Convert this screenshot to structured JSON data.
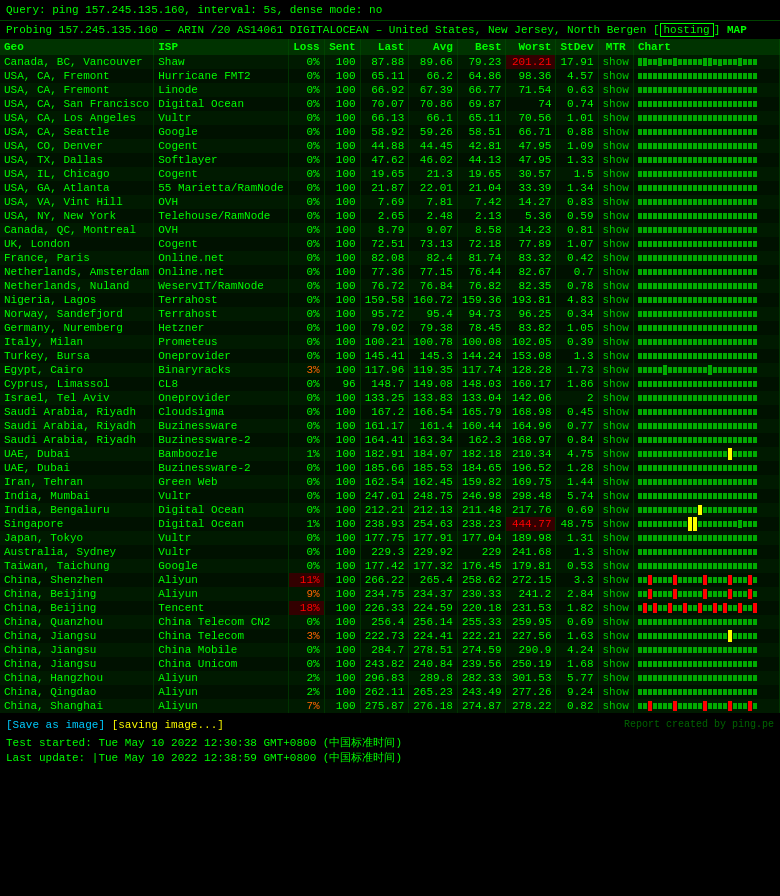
{
  "query_bar": {
    "text": "Query: ping 157.245.135.160, interval: 5s, dense mode: no"
  },
  "probe_bar": {
    "text": "Probing 157.245.135.160 – ARIN /20 AS14061 DIGITALOCEAN – United States, New Jersey, North Bergen",
    "hosting_label": "hosting",
    "map_label": "MAP"
  },
  "table": {
    "headers": [
      "Geo",
      "ISP",
      "Loss",
      "Sent",
      "Last",
      "Avg",
      "Best",
      "Worst",
      "StDev",
      "MTR",
      "Chart"
    ],
    "rows": [
      {
        "geo": "Canada, BC, Vancouver",
        "isp": "Shaw",
        "loss": "0%",
        "sent": 100,
        "last": 87.88,
        "avg": 89.66,
        "best": 79.23,
        "worst": 201.21,
        "stdev": 17.91,
        "mtr": "show",
        "worst_high": true,
        "chart": "green_dense"
      },
      {
        "geo": "USA, CA, Fremont",
        "isp": "Hurricane FMT2",
        "loss": "0%",
        "sent": 100,
        "last": 65.11,
        "avg": 66.2,
        "best": 64.86,
        "worst": 98.36,
        "stdev": 4.57,
        "mtr": "show",
        "worst_high": false,
        "chart": "green_flat"
      },
      {
        "geo": "USA, CA, Fremont",
        "isp": "Linode",
        "loss": "0%",
        "sent": 100,
        "last": 66.92,
        "avg": 67.39,
        "best": 66.77,
        "worst": 71.54,
        "stdev": 0.63,
        "mtr": "show",
        "worst_high": false,
        "chart": "green_flat"
      },
      {
        "geo": "USA, CA, San Francisco",
        "isp": "Digital Ocean",
        "loss": "0%",
        "sent": 100,
        "last": 70.07,
        "avg": 70.86,
        "best": 69.87,
        "worst": 74,
        "stdev": 0.74,
        "mtr": "show",
        "worst_high": false,
        "chart": "green_flat"
      },
      {
        "geo": "USA, CA, Los Angeles",
        "isp": "Vultr",
        "loss": "0%",
        "sent": 100,
        "last": 66.13,
        "avg": 66.1,
        "best": 65.11,
        "worst": 70.56,
        "stdev": 1.01,
        "mtr": "show",
        "worst_high": false,
        "chart": "green_flat"
      },
      {
        "geo": "USA, CA, Seattle",
        "isp": "Google",
        "loss": "0%",
        "sent": 100,
        "last": 58.92,
        "avg": 59.26,
        "best": 58.51,
        "worst": 66.71,
        "stdev": 0.88,
        "mtr": "show",
        "worst_high": false,
        "chart": "green_flat"
      },
      {
        "geo": "USA, CO, Denver",
        "isp": "Cogent",
        "loss": "0%",
        "sent": 100,
        "last": 44.88,
        "avg": 44.45,
        "best": 42.81,
        "worst": 47.95,
        "stdev": 1.09,
        "mtr": "show",
        "worst_high": false,
        "chart": "green_flat"
      },
      {
        "geo": "USA, TX, Dallas",
        "isp": "Softlayer",
        "loss": "0%",
        "sent": 100,
        "last": 47.62,
        "avg": 46.02,
        "best": 44.13,
        "worst": 47.95,
        "stdev": 1.33,
        "mtr": "show",
        "worst_high": false,
        "chart": "green_flat"
      },
      {
        "geo": "USA, IL, Chicago",
        "isp": "Cogent",
        "loss": "0%",
        "sent": 100,
        "last": 19.65,
        "avg": 21.3,
        "best": 19.65,
        "worst": 30.57,
        "stdev": 1.5,
        "mtr": "show",
        "worst_high": false,
        "chart": "green_flat"
      },
      {
        "geo": "USA, GA, Atlanta",
        "isp": "55 Marietta/RamNode",
        "loss": "0%",
        "sent": 100,
        "last": 21.87,
        "avg": 22.01,
        "best": 21.04,
        "worst": 33.39,
        "stdev": 1.34,
        "mtr": "show",
        "worst_high": false,
        "chart": "green_flat"
      },
      {
        "geo": "USA, VA, Vint Hill",
        "isp": "OVH",
        "loss": "0%",
        "sent": 100,
        "last": 7.69,
        "avg": 7.81,
        "best": 7.42,
        "worst": 14.27,
        "stdev": 0.83,
        "mtr": "show",
        "worst_high": false,
        "chart": "green_flat"
      },
      {
        "geo": "USA, NY, New York",
        "isp": "Telehouse/RamNode",
        "loss": "0%",
        "sent": 100,
        "last": 2.65,
        "avg": 2.48,
        "best": 2.13,
        "worst": 5.36,
        "stdev": 0.59,
        "mtr": "show",
        "worst_high": false,
        "chart": "green_flat"
      },
      {
        "geo": "Canada, QC, Montreal",
        "isp": "OVH",
        "loss": "0%",
        "sent": 100,
        "last": 8.79,
        "avg": 9.07,
        "best": 8.58,
        "worst": 14.23,
        "stdev": 0.81,
        "mtr": "show",
        "worst_high": false,
        "chart": "green_flat"
      },
      {
        "geo": "UK, London",
        "isp": "Cogent",
        "loss": "0%",
        "sent": 100,
        "last": 72.51,
        "avg": 73.13,
        "best": 72.18,
        "worst": 77.89,
        "stdev": 1.07,
        "mtr": "show",
        "worst_high": false,
        "chart": "green_flat"
      },
      {
        "geo": "France, Paris",
        "isp": "Online.net",
        "loss": "0%",
        "sent": 100,
        "last": 82.08,
        "avg": 82.4,
        "best": 81.74,
        "worst": 83.32,
        "stdev": 0.42,
        "mtr": "show",
        "worst_high": false,
        "chart": "green_flat"
      },
      {
        "geo": "Netherlands, Amsterdam",
        "isp": "Online.net",
        "loss": "0%",
        "sent": 100,
        "last": 77.36,
        "avg": 77.15,
        "best": 76.44,
        "worst": 82.67,
        "stdev": 0.7,
        "mtr": "show",
        "worst_high": false,
        "chart": "green_flat"
      },
      {
        "geo": "Netherlands, Nuland",
        "isp": "WeservIT/RamNode",
        "loss": "0%",
        "sent": 100,
        "last": 76.72,
        "avg": 76.84,
        "best": 76.82,
        "worst": 82.35,
        "stdev": 0.78,
        "mtr": "show",
        "worst_high": false,
        "chart": "green_flat"
      },
      {
        "geo": "Nigeria, Lagos",
        "isp": "Terrahost",
        "loss": "0%",
        "sent": 100,
        "last": 159.58,
        "avg": 160.72,
        "best": 159.36,
        "worst": 193.81,
        "stdev": 4.83,
        "mtr": "show",
        "worst_high": false,
        "chart": "green_flat"
      },
      {
        "geo": "Norway, Sandefjord",
        "isp": "Terrahost",
        "loss": "0%",
        "sent": 100,
        "last": 95.72,
        "avg": 95.4,
        "best": 94.73,
        "worst": 96.25,
        "stdev": 0.34,
        "mtr": "show",
        "worst_high": false,
        "chart": "green_flat"
      },
      {
        "geo": "Germany, Nuremberg",
        "isp": "Hetzner",
        "loss": "0%",
        "sent": 100,
        "last": 79.02,
        "avg": 79.38,
        "best": 78.45,
        "worst": 83.82,
        "stdev": 1.05,
        "mtr": "show",
        "worst_high": false,
        "chart": "green_flat"
      },
      {
        "geo": "Italy, Milan",
        "isp": "Prometeus",
        "loss": "0%",
        "sent": 100,
        "last": 100.21,
        "avg": 100.78,
        "best": 100.08,
        "worst": 102.05,
        "stdev": 0.39,
        "mtr": "show",
        "worst_high": false,
        "chart": "green_flat"
      },
      {
        "geo": "Turkey, Bursa",
        "isp": "Oneprovider",
        "loss": "0%",
        "sent": 100,
        "last": 145.41,
        "avg": 145.3,
        "best": 144.24,
        "worst": 153.08,
        "stdev": 1.3,
        "mtr": "show",
        "worst_high": false,
        "chart": "green_flat"
      },
      {
        "geo": "Egypt, Cairo",
        "isp": "Binaryracks",
        "loss": "3%",
        "sent": 100,
        "last": 117.96,
        "avg": 119.35,
        "best": 117.74,
        "worst": 128.28,
        "stdev": 1.73,
        "mtr": "show",
        "worst_high": false,
        "loss_warn": true,
        "chart": "green_spikes"
      },
      {
        "geo": "Cyprus, Limassol",
        "isp": "CL8",
        "loss": "0%",
        "sent": 96,
        "last": 148.7,
        "avg": 149.08,
        "best": 148.03,
        "worst": 160.17,
        "stdev": 1.86,
        "mtr": "show",
        "worst_high": false,
        "chart": "green_flat"
      },
      {
        "geo": "Israel, Tel Aviv",
        "isp": "Oneprovider",
        "loss": "0%",
        "sent": 100,
        "last": 133.25,
        "avg": 133.83,
        "best": 133.04,
        "worst": 142.06,
        "stdev": 2,
        "mtr": "show",
        "worst_high": false,
        "chart": "green_flat"
      },
      {
        "geo": "Saudi Arabia, Riyadh",
        "isp": "Cloudsigma",
        "loss": "0%",
        "sent": 100,
        "last": 167.2,
        "avg": 166.54,
        "best": 165.79,
        "worst": 168.98,
        "stdev": 0.45,
        "mtr": "show",
        "worst_high": false,
        "chart": "green_flat"
      },
      {
        "geo": "Saudi Arabia, Riyadh",
        "isp": "Buzinessware",
        "loss": "0%",
        "sent": 100,
        "last": 161.17,
        "avg": 161.4,
        "best": 160.44,
        "worst": 164.96,
        "stdev": 0.77,
        "mtr": "show",
        "worst_high": false,
        "chart": "green_flat"
      },
      {
        "geo": "Saudi Arabia, Riyadh",
        "isp": "Buzinessware-2",
        "loss": "0%",
        "sent": 100,
        "last": 164.41,
        "avg": 163.34,
        "best": 162.3,
        "worst": 168.97,
        "stdev": 0.84,
        "mtr": "show",
        "worst_high": false,
        "chart": "green_flat"
      },
      {
        "geo": "UAE, Dubai",
        "isp": "Bamboozle",
        "loss": "1%",
        "sent": 100,
        "last": 182.91,
        "avg": 184.07,
        "best": 182.18,
        "worst": 210.34,
        "stdev": 4.75,
        "mtr": "show",
        "worst_high": false,
        "chart": "green_spike_one"
      },
      {
        "geo": "UAE, Dubai",
        "isp": "Buzinessware-2",
        "loss": "0%",
        "sent": 100,
        "last": 185.66,
        "avg": 185.53,
        "best": 184.65,
        "worst": 196.52,
        "stdev": 1.28,
        "mtr": "show",
        "worst_high": false,
        "chart": "green_flat"
      },
      {
        "geo": "Iran, Tehran",
        "isp": "Green Web",
        "loss": "0%",
        "sent": 100,
        "last": 162.54,
        "avg": 162.45,
        "best": 159.82,
        "worst": 169.75,
        "stdev": 1.44,
        "mtr": "show",
        "worst_high": false,
        "chart": "green_flat"
      },
      {
        "geo": "India, Mumbai",
        "isp": "Vultr",
        "loss": "0%",
        "sent": 100,
        "last": 247.01,
        "avg": 248.75,
        "best": 246.98,
        "worst": 298.48,
        "stdev": 5.74,
        "mtr": "show",
        "worst_high": false,
        "chart": "green_flat"
      },
      {
        "geo": "India, Bengaluru",
        "isp": "Digital Ocean",
        "loss": "0%",
        "sent": 100,
        "last": 212.21,
        "avg": 212.13,
        "best": 211.48,
        "worst": 217.76,
        "stdev": 0.69,
        "mtr": "show",
        "worst_high": false,
        "chart": "green_yellow_spike"
      },
      {
        "geo": "Singapore",
        "isp": "Digital Ocean",
        "loss": "1%",
        "sent": 100,
        "last": 238.93,
        "avg": 254.63,
        "best": 238.23,
        "worst": 444.77,
        "stdev": 48.75,
        "mtr": "show",
        "worst_high": true,
        "chart": "green_yellow_large_spike"
      },
      {
        "geo": "Japan, Tokyo",
        "isp": "Vultr",
        "loss": "0%",
        "sent": 100,
        "last": 177.75,
        "avg": 177.91,
        "best": 177.04,
        "worst": 189.98,
        "stdev": 1.31,
        "mtr": "show",
        "worst_high": false,
        "chart": "green_flat"
      },
      {
        "geo": "Australia, Sydney",
        "isp": "Vultr",
        "loss": "0%",
        "sent": 100,
        "last": 229.3,
        "avg": 229.92,
        "best": 229,
        "worst": 241.68,
        "stdev": 1.3,
        "mtr": "show",
        "worst_high": false,
        "chart": "green_flat"
      },
      {
        "geo": "Taiwan, Taichung",
        "isp": "Google",
        "loss": "0%",
        "sent": 100,
        "last": 177.42,
        "avg": 177.32,
        "best": 176.45,
        "worst": 179.81,
        "stdev": 0.53,
        "mtr": "show",
        "worst_high": false,
        "chart": "green_flat"
      },
      {
        "geo": "China, Shenzhen",
        "isp": "Aliyun",
        "loss": "11%",
        "sent": 100,
        "last": 266.22,
        "avg": 265.4,
        "best": 258.62,
        "worst": 272.15,
        "stdev": 3.3,
        "mtr": "show",
        "worst_high": false,
        "loss_high": true,
        "chart": "green_red_spikes"
      },
      {
        "geo": "China, Beijing",
        "isp": "Aliyun",
        "loss": "9%",
        "sent": 100,
        "last": 234.75,
        "avg": 234.37,
        "best": 230.33,
        "worst": 241.2,
        "stdev": 2.84,
        "mtr": "show",
        "worst_high": false,
        "loss_warn": true,
        "chart": "green_red_spikes"
      },
      {
        "geo": "China, Beijing",
        "isp": "Tencent",
        "loss": "18%",
        "sent": 100,
        "last": 226.33,
        "avg": 224.59,
        "best": 220.18,
        "worst": 231.53,
        "stdev": 1.82,
        "mtr": "show",
        "worst_high": false,
        "loss_high": true,
        "chart": "green_red_many"
      },
      {
        "geo": "China, Quanzhou",
        "isp": "China Telecom CN2",
        "loss": "0%",
        "sent": 100,
        "last": 256.4,
        "avg": 256.14,
        "best": 255.33,
        "worst": 259.95,
        "stdev": 0.69,
        "mtr": "show",
        "worst_high": false,
        "chart": "green_flat"
      },
      {
        "geo": "China, Jiangsu",
        "isp": "China Telecom",
        "loss": "3%",
        "sent": 100,
        "last": 222.73,
        "avg": 224.41,
        "best": 222.21,
        "worst": 227.56,
        "stdev": 1.63,
        "mtr": "show",
        "worst_high": false,
        "loss_warn": true,
        "chart": "green_spike_one"
      },
      {
        "geo": "China, Jiangsu",
        "isp": "China Mobile",
        "loss": "0%",
        "sent": 100,
        "last": 284.7,
        "avg": 278.51,
        "best": 274.59,
        "worst": 290.9,
        "stdev": 4.24,
        "mtr": "show",
        "worst_high": false,
        "chart": "green_flat"
      },
      {
        "geo": "China, Jiangsu",
        "isp": "China Unicom",
        "loss": "0%",
        "sent": 100,
        "last": 243.82,
        "avg": 240.84,
        "best": 239.56,
        "worst": 250.19,
        "stdev": 1.68,
        "mtr": "show",
        "worst_high": false,
        "chart": "green_flat"
      },
      {
        "geo": "China, Hangzhou",
        "isp": "Aliyun",
        "loss": "2%",
        "sent": 100,
        "last": 296.83,
        "avg": 289.8,
        "best": 282.33,
        "worst": 301.53,
        "stdev": 5.77,
        "mtr": "show",
        "worst_high": false,
        "chart": "green_flat"
      },
      {
        "geo": "China, Qingdao",
        "isp": "Aliyun",
        "loss": "2%",
        "sent": 100,
        "last": 262.11,
        "avg": 265.23,
        "best": 243.49,
        "worst": 277.26,
        "stdev": 9.24,
        "mtr": "show",
        "worst_high": false,
        "chart": "green_flat"
      },
      {
        "geo": "China, Shanghai",
        "isp": "Aliyun",
        "loss": "7%",
        "sent": 100,
        "last": 275.87,
        "avg": 276.18,
        "best": 274.87,
        "worst": 278.22,
        "stdev": 0.82,
        "mtr": "show",
        "worst_high": false,
        "loss_warn": true,
        "chart": "green_red_spikes"
      }
    ]
  },
  "footer": {
    "save_label": "[Save as image]",
    "saving_label": "[saving image...]",
    "report_label": "Report created by ping.pe",
    "test_started": "Test started: Tue May 10 2022 12:30:38 GMT+0800 (中国标准时间)",
    "last_update": "Last update: |Tue May 10 2022 12:38:59 GMT+0800 (中国标准时间)"
  }
}
